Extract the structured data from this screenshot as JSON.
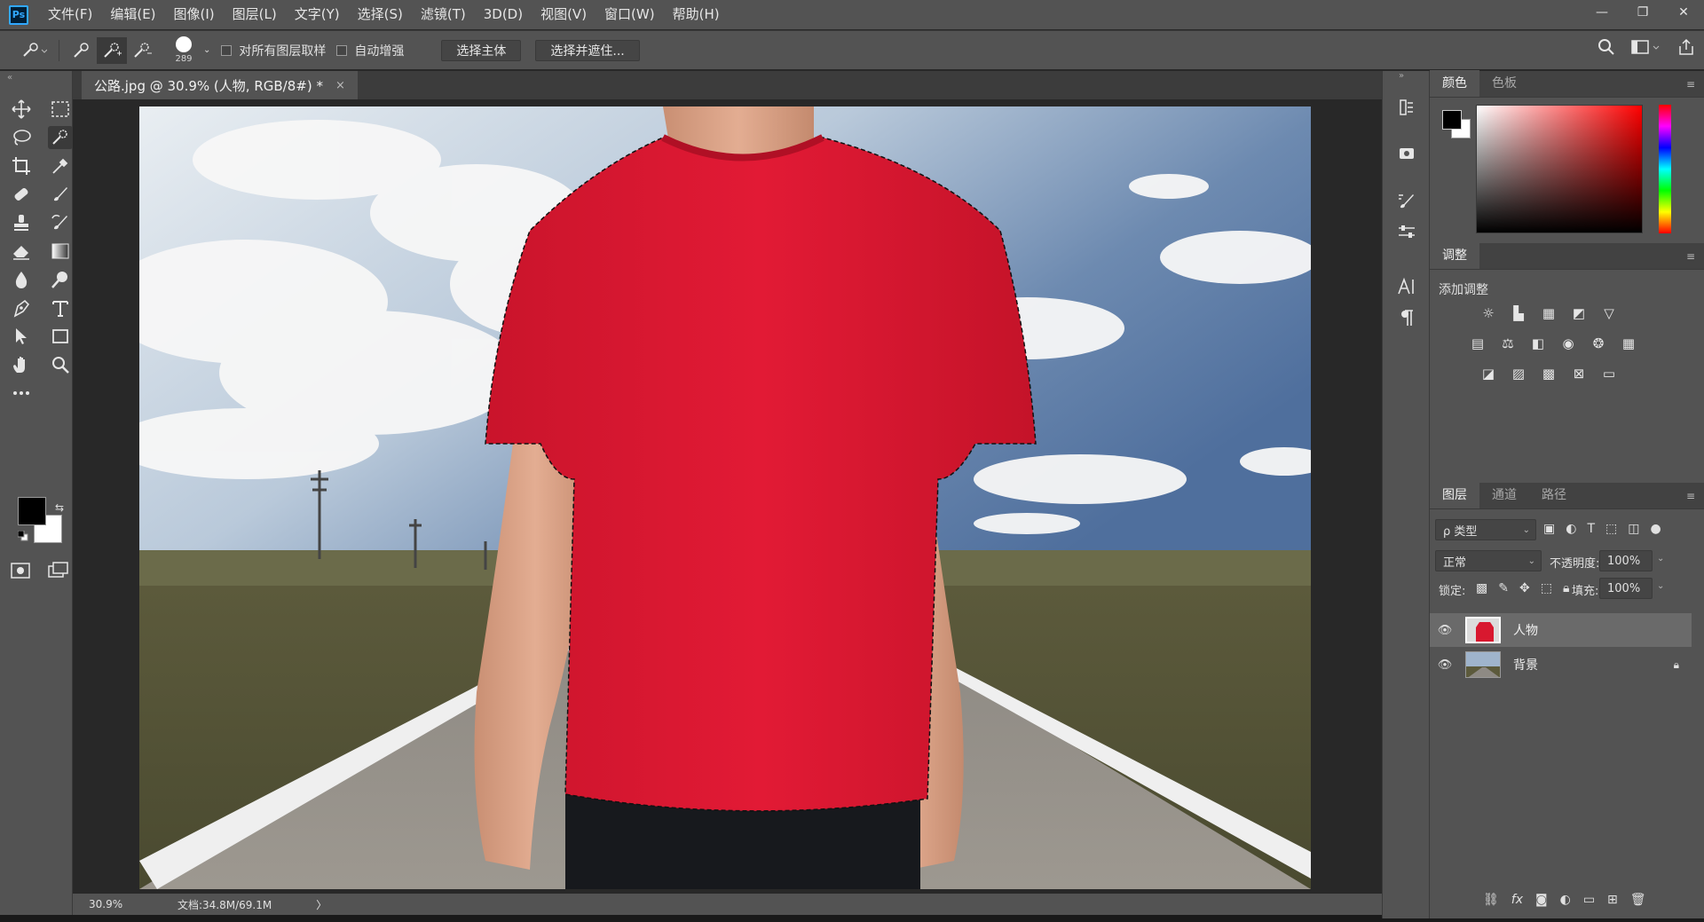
{
  "app": {
    "logo": "Ps",
    "menus": [
      "文件(F)",
      "编辑(E)",
      "图像(I)",
      "图层(L)",
      "文字(Y)",
      "选择(S)",
      "滤镜(T)",
      "3D(D)",
      "视图(V)",
      "窗口(W)",
      "帮助(H)"
    ],
    "window_controls": [
      "—",
      "❐",
      "✕"
    ]
  },
  "options": {
    "brush_size": "289",
    "sample_all_layers": "对所有图层取样",
    "auto_enhance": "自动增强",
    "select_subject": "选择主体",
    "select_and_mask": "选择并遮住..."
  },
  "document": {
    "tab_title": "公路.jpg @ 30.9% (人物, RGB/8#) *",
    "tab_close": "×",
    "zoom": "30.9%",
    "doc_size": "文档:34.8M/69.1M",
    "status_arrow": "〉"
  },
  "panels": {
    "color": {
      "tab_color": "颜色",
      "tab_swatches": "色板"
    },
    "adjustments": {
      "title": "调整",
      "add": "添加调整"
    },
    "layers": {
      "tabs": [
        "图层",
        "通道",
        "路径"
      ],
      "filter": "ρ 类型",
      "blend_mode": "正常",
      "opacity_label": "不透明度:",
      "opacity": "100%",
      "lock_label": "锁定:",
      "fill_label": "填充:",
      "fill": "100%",
      "items": [
        {
          "name": "人物",
          "selected": true
        },
        {
          "name": "背景",
          "selected": false,
          "locked": true
        }
      ],
      "footer_fx": "fx"
    }
  },
  "colors": {
    "foreground": "#000000",
    "background": "#ffffff",
    "shirt": "#d8182f",
    "accent": "#31a8ff"
  }
}
